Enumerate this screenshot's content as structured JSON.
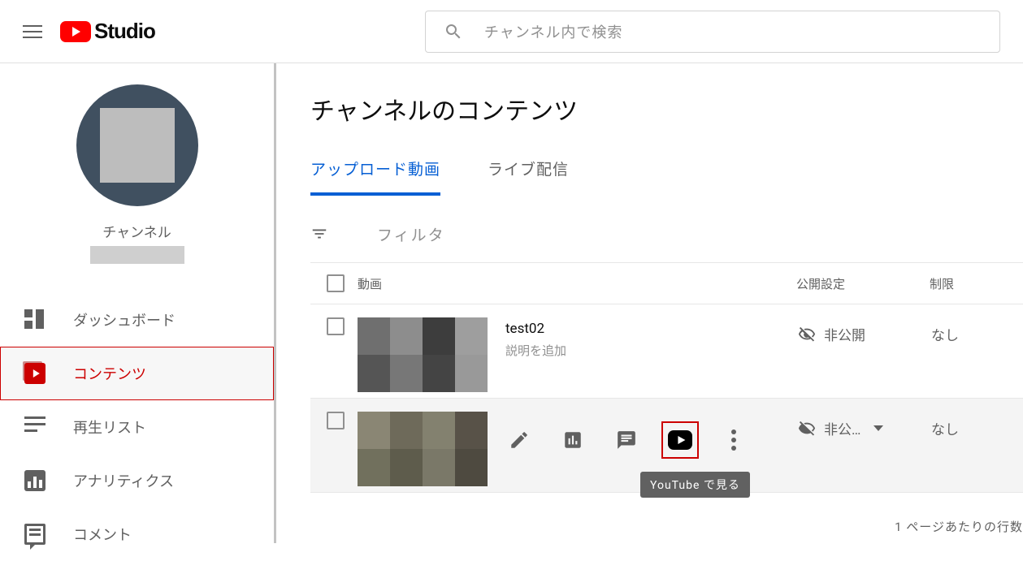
{
  "header": {
    "logo_text": "Studio",
    "search_placeholder": "チャンネル内で検索"
  },
  "sidebar": {
    "channel_label": "チャンネル",
    "items": [
      {
        "label": "ダッシュボード"
      },
      {
        "label": "コンテンツ"
      },
      {
        "label": "再生リスト"
      },
      {
        "label": "アナリティクス"
      },
      {
        "label": "コメント"
      }
    ]
  },
  "page": {
    "title": "チャンネルのコンテンツ"
  },
  "tabs": [
    {
      "label": "アップロード動画",
      "active": true
    },
    {
      "label": "ライブ配信",
      "active": false
    }
  ],
  "filter": {
    "placeholder": "フィルタ"
  },
  "table": {
    "headers": {
      "video": "動画",
      "visibility": "公開設定",
      "restrictions": "制限"
    },
    "rows": [
      {
        "title": "test02",
        "description": "説明を追加",
        "visibility": "非公開",
        "restrictions": "なし",
        "hover": false
      },
      {
        "title": "",
        "description": "",
        "visibility": "非公…",
        "restrictions": "なし",
        "hover": true
      }
    ]
  },
  "hover_tooltip": "YouTube で見る",
  "pagination_label": "1 ページあたりの行数"
}
